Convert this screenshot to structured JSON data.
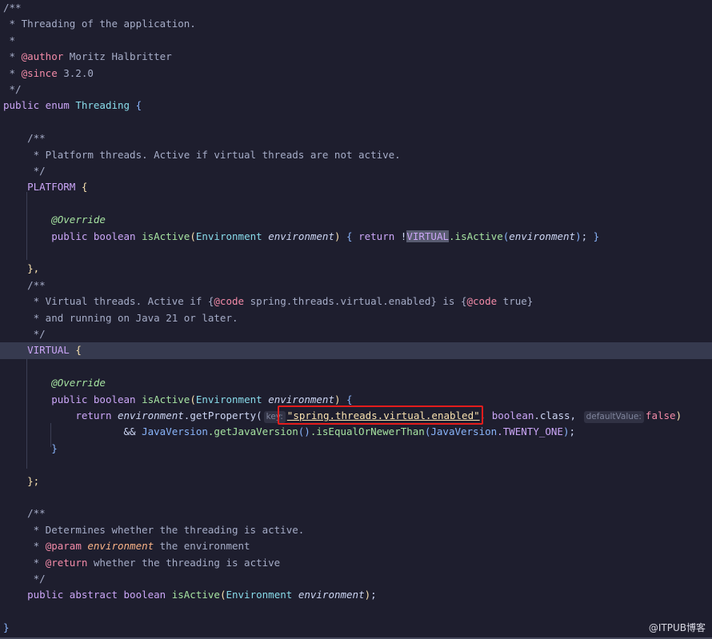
{
  "editor": {
    "language": "Java",
    "lines": {
      "l1": "/**",
      "l2": " * Threading of the application.",
      "l3": " *",
      "l4_tag": "@author",
      "l4_text": " Moritz Halbritter",
      "l5_tag": "@since",
      "l5_text": " 3.2.0",
      "l6": " */",
      "l7_kw": "public enum ",
      "l7_name": "Threading",
      "l9": "/**",
      "l10": " * Platform threads. Active if virtual threads are not active.",
      "l11": " */",
      "l12_name": "PLATFORM",
      "l14_anno": "@Override",
      "l15_kw": "public boolean ",
      "l15_method": "isActive",
      "l15_type": "Environment",
      "l15_param": "environment",
      "l15_return": "return",
      "l15_not": " !",
      "l15_virtual": "VIRTUAL",
      "l15_call": ".isActive",
      "l17_end": "},",
      "l18": "/**",
      "l19_a": " * Virtual threads. Active if {",
      "l19_code1": "@code",
      "l19_b": " spring.threads.virtual.enabled} is {",
      "l19_code2": "@code",
      "l19_c": " true}",
      "l20": " * and running on Java 21 or later.",
      "l21": " */",
      "l22_name": "VIRTUAL",
      "l24_anno": "@Override",
      "l25_kw": "public boolean ",
      "l25_method": "isActive",
      "l25_type": "Environment",
      "l25_param": "environment",
      "l26_return": "return ",
      "l26_env": "environment",
      "l26_call": ".getProperty(",
      "l26_hint_key": "key:",
      "l26_string": "\"spring.threads.virtual.enabled\"",
      "l26_bool": "boolean",
      "l26_class": ".class,",
      "l26_hint_default": "defaultValue:",
      "l26_false": "false",
      "l27_and": "&& ",
      "l27_java": "JavaVersion",
      "l27_get": ".getJavaVersion",
      "l27_cmp": ".isEqualOrNewerThan",
      "l27_java2": "JavaVersion",
      "l27_const": ".TWENTY_ONE",
      "l28_end": "}",
      "l30_end": "};",
      "l32": "/**",
      "l33": " * Determines whether the threading is active.",
      "l34_tag": "@param",
      "l34_param": " environment",
      "l34_text": " the environment",
      "l35_tag": "@return",
      "l35_text": " whether the threading is active",
      "l36": " */",
      "l37_kw": "public abstract boolean ",
      "l37_method": "isActive",
      "l37_type": "Environment",
      "l37_param": "environment",
      "l39_end": "}"
    }
  },
  "watermark": "@ITPUB博客",
  "colors": {
    "background": "#1e1e2e",
    "highlight_line": "#363a4f",
    "annotation_box": "#e41c1c"
  }
}
